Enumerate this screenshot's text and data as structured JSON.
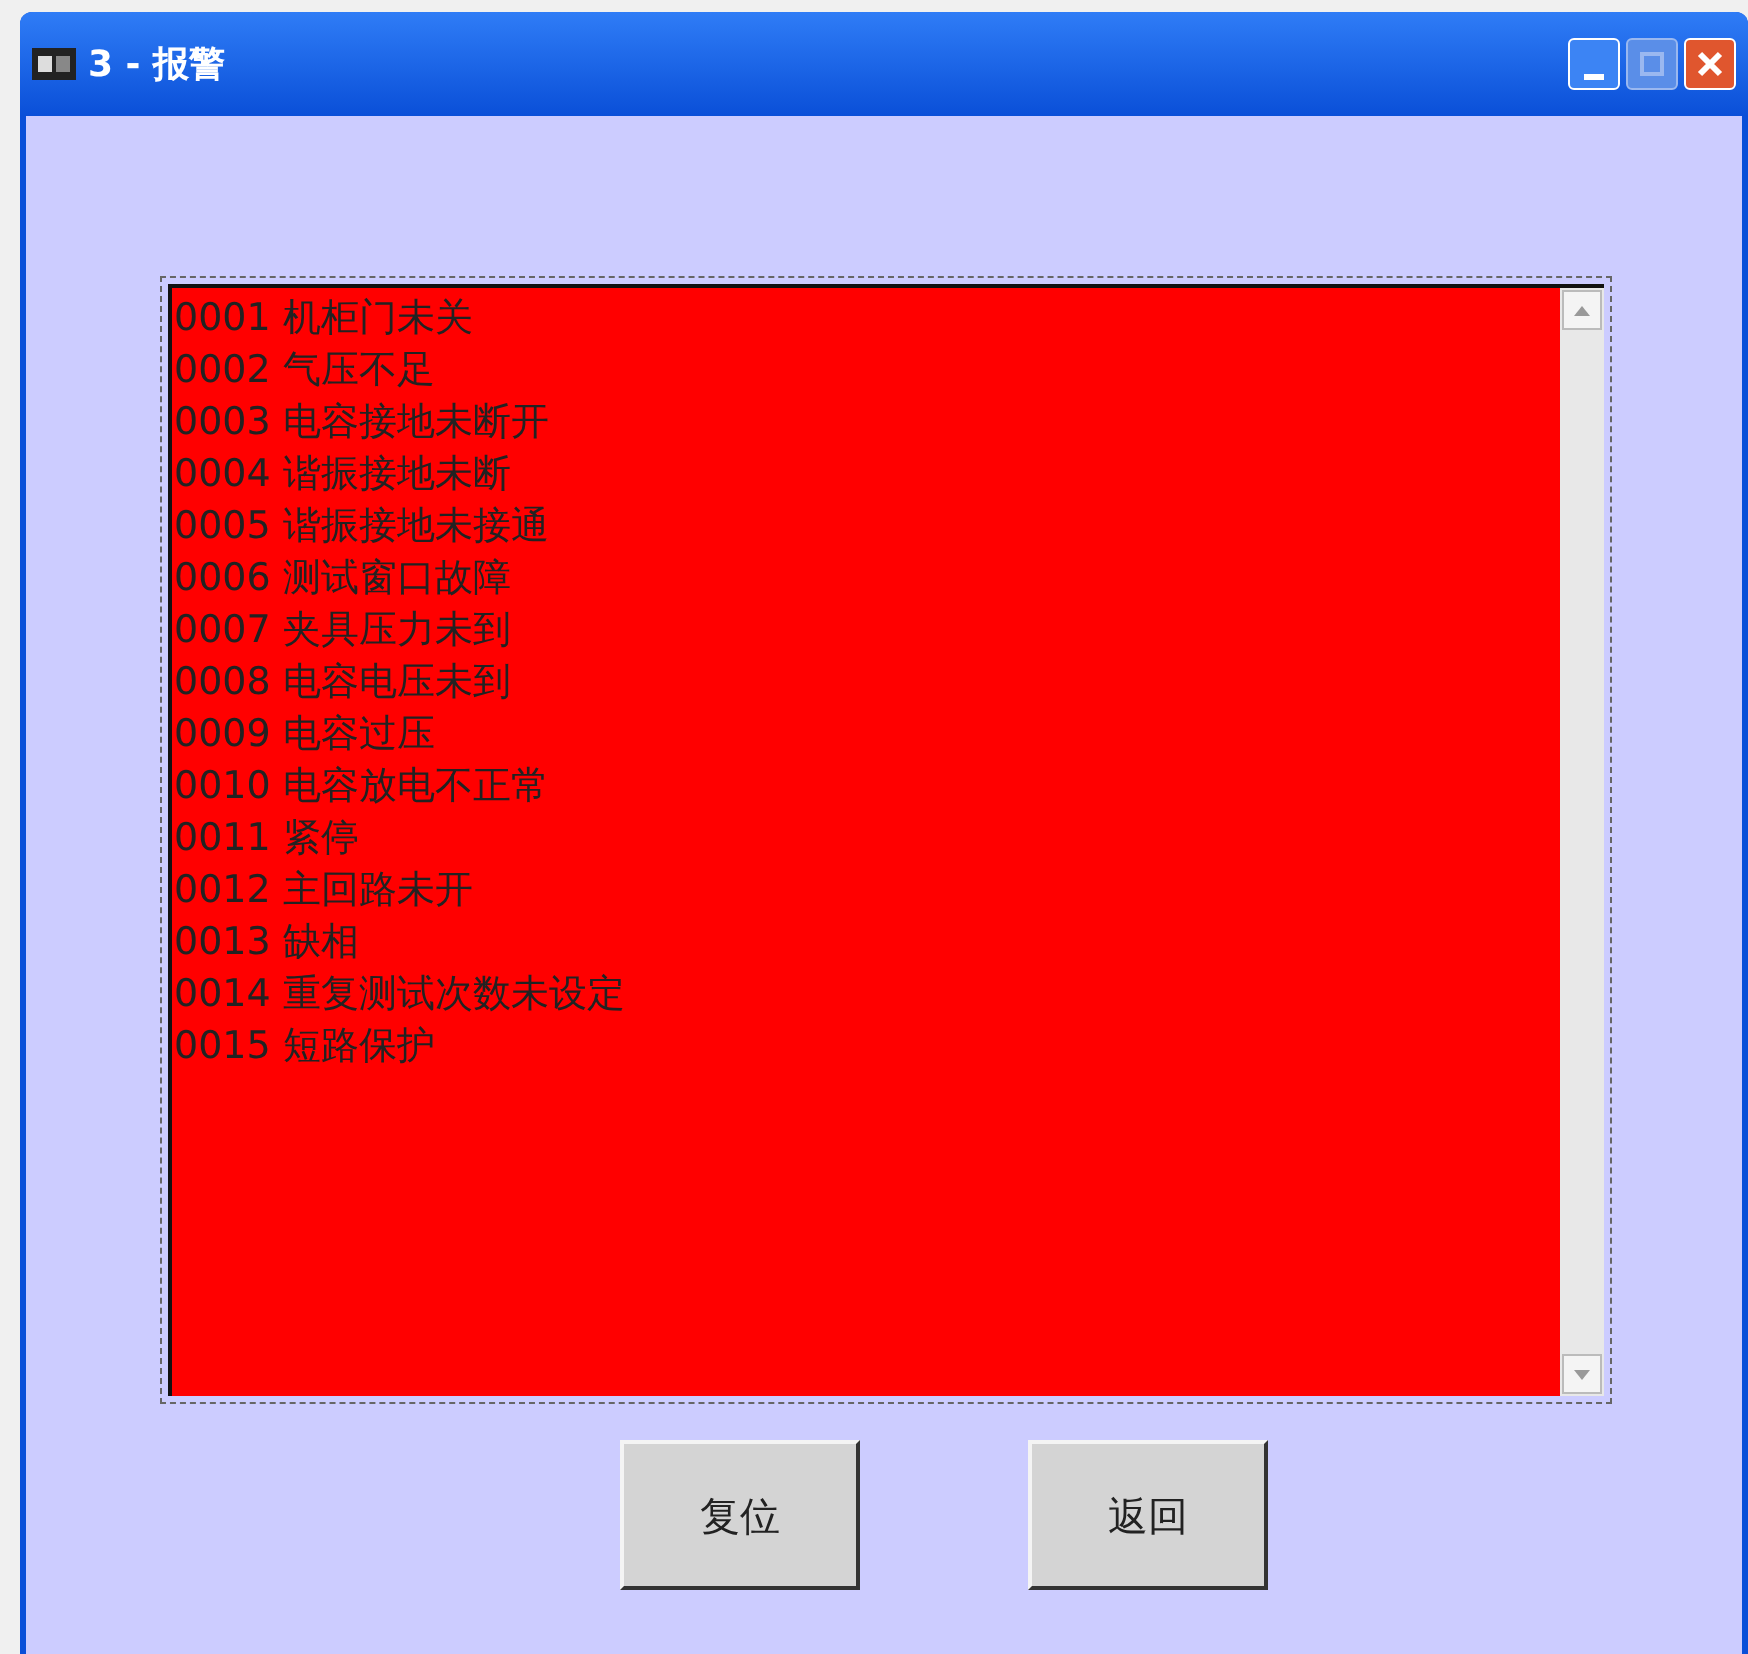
{
  "window": {
    "title": "3 - 报警"
  },
  "alarm_list": {
    "items": [
      "0001 机柜门未关",
      "0002 气压不足",
      "0003 电容接地未断开",
      "0004 谐振接地未断",
      "0005 谐振接地未接通",
      "0006 测试窗口故障",
      "0007 夹具压力未到",
      "0008 电容电压未到",
      "0009 电容过压",
      "0010 电容放电不正常",
      "0011 紧停",
      "0012 主回路未开",
      "0013 缺相",
      "0014 重复测试次数未设定",
      "0015 短路保护"
    ]
  },
  "buttons": [
    "复位",
    "返回"
  ]
}
